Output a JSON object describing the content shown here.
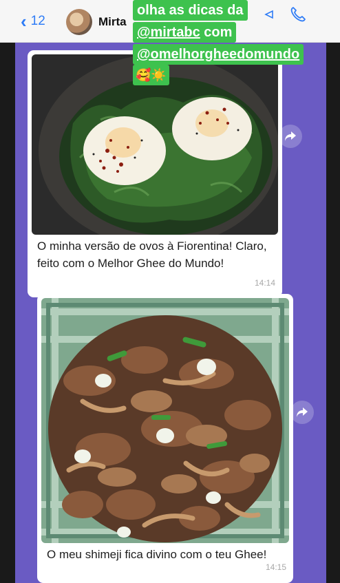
{
  "header": {
    "back_count": "12",
    "contact_name": "Mirta"
  },
  "messages": [
    {
      "caption": "O minha versão de ovos à Fiorentina! Claro, feito com o Melhor Ghee do Mundo!",
      "time": "14:14"
    },
    {
      "caption": "O meu shimeji fica divino com o teu Ghee!",
      "time": "14:15"
    }
  ],
  "sticker": {
    "line1": "olha as dicas da",
    "line2": "@mirtabc",
    "line2_suffix": " com",
    "line3": "@omelhorgheedomundo",
    "line4": "🥰☀️"
  },
  "colors": {
    "chat_bg": "#6a5bc3",
    "sticker_bg": "#3ec24e",
    "accent": "#2e7cf6"
  }
}
